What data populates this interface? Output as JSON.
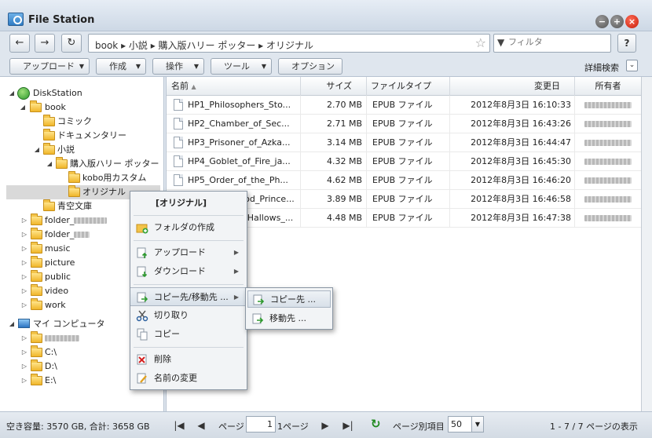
{
  "window": {
    "title": "File Station"
  },
  "addressbar": {
    "path": "book ▸ 小説 ▸ 購入版ハリー ポッター ▸ オリジナル",
    "filter_placeholder": "フィルタ",
    "help_label": "?"
  },
  "toolbar": {
    "buttons": [
      "アップロード",
      "作成",
      "操作",
      "ツール",
      "オプション"
    ],
    "advanced_search": "詳細検索"
  },
  "tree": {
    "root": "DiskStation",
    "book": "book",
    "comic": "コミック",
    "documentary": "ドキュメンタリー",
    "novel": "小説",
    "purchased": "購入版ハリー ポッター",
    "kobo": "kobo用カスタム",
    "original": "オリジナル",
    "aozora": "青空文庫",
    "folder1": "folder_",
    "folder2": "folder_",
    "music": "music",
    "picture": "picture",
    "public": "public",
    "video": "video",
    "work": "work",
    "my_computer": "マイ コンピュータ",
    "drive_c": "C:\\",
    "drive_d": "D:\\",
    "drive_e": "E:\\"
  },
  "grid": {
    "columns": [
      "名前",
      "サイズ",
      "ファイルタイプ",
      "変更日",
      "所有者"
    ],
    "rows": [
      {
        "name": "HP1_Philosophers_Sto...",
        "size": "2.70 MB",
        "type": "EPUB ファイル",
        "modified": "2012年8月3日  16:10:33"
      },
      {
        "name": "HP2_Chamber_of_Sec...",
        "size": "2.71 MB",
        "type": "EPUB ファイル",
        "modified": "2012年8月3日  16:43:26"
      },
      {
        "name": "HP3_Prisoner_of_Azka...",
        "size": "3.14 MB",
        "type": "EPUB ファイル",
        "modified": "2012年8月3日  16:44:47"
      },
      {
        "name": "HP4_Goblet_of_Fire_ja...",
        "size": "4.32 MB",
        "type": "EPUB ファイル",
        "modified": "2012年8月3日  16:45:30"
      },
      {
        "name": "HP5_Order_of_the_Ph...",
        "size": "4.62 MB",
        "type": "EPUB ファイル",
        "modified": "2012年8月3日  16:46:20"
      },
      {
        "name": "HP6_Half_Blood_Prince...",
        "size": "3.89 MB",
        "type": "EPUB ファイル",
        "modified": "2012年8月3日  16:46:58"
      },
      {
        "name": "HP7_Deathly_Hallows_...",
        "size": "4.48 MB",
        "type": "EPUB ファイル",
        "modified": "2012年8月3日  16:47:38"
      }
    ]
  },
  "context_menu": {
    "header": "[オリジナル]",
    "create_folder": "フォルダの作成",
    "upload": "アップロード",
    "download": "ダウンロード",
    "copy_move": "コピー先/移動先 ...",
    "cut": "切り取り",
    "copy": "コピー",
    "delete": "削除",
    "rename": "名前の変更"
  },
  "submenu": {
    "copy_to": "コピー先 ...",
    "move_to": "移動先 ..."
  },
  "status": {
    "free_space": "空き容量: 3570 GB, 合計: 3658 GB",
    "page_label": "ページ",
    "page_value": "1",
    "page_of": "1ページ",
    "per_page_label": "ページ別項目",
    "per_page_value": "50",
    "display_range": "1 - 7 / 7 ページの表示"
  },
  "colors": {
    "accent": "#2f7cc4",
    "selection": "#d9d9d9",
    "close_button": "#e0341e"
  }
}
